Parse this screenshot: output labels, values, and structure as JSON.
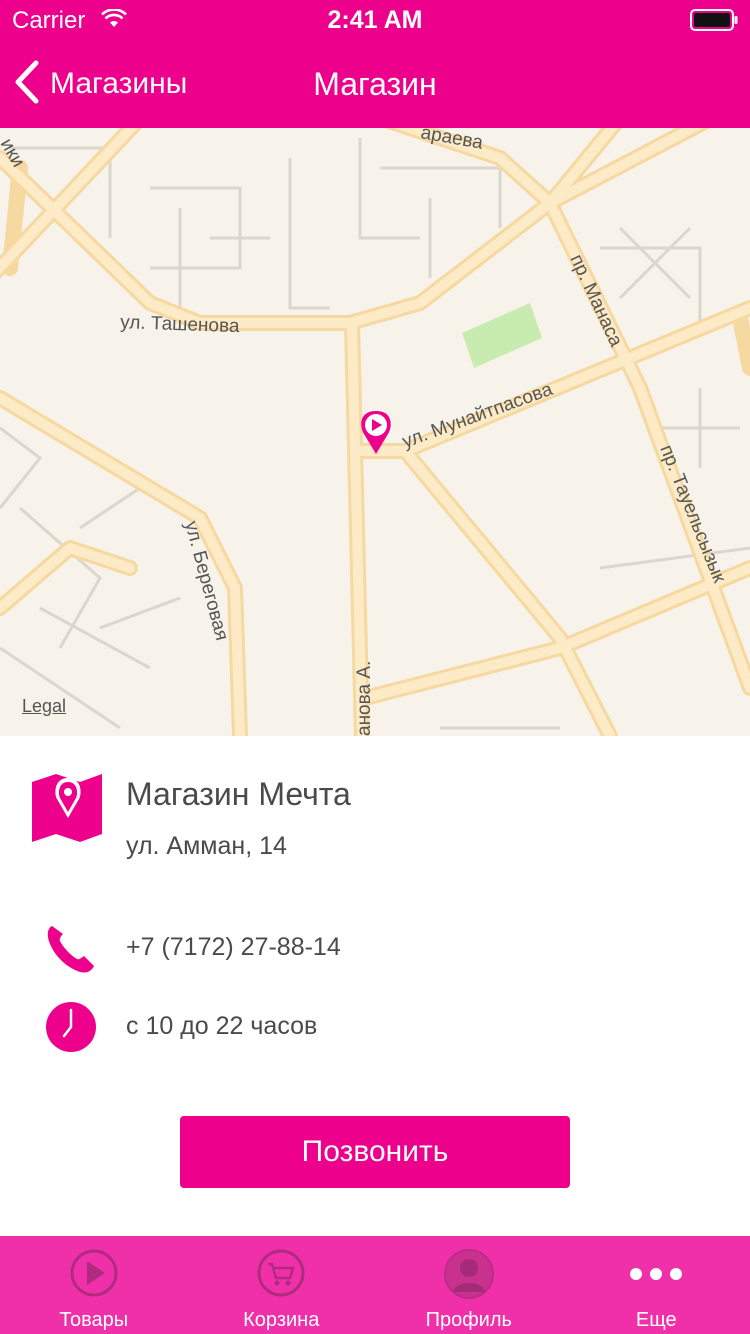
{
  "status_bar": {
    "carrier": "Carrier",
    "time": "2:41 AM"
  },
  "nav": {
    "back_label": "Магазины",
    "title": "Магазин"
  },
  "map": {
    "legal": "Legal",
    "streets": [
      "ул. Ташенова",
      "ул. Мунайтпасова",
      "пр. Манаса",
      "пр. Тауельсызык",
      "ул. Береговая",
      "анова А.",
      "араева",
      "ики"
    ]
  },
  "store": {
    "name": "Магазин Мечта",
    "address": "ул. Амман, 14",
    "phone": "+7 (7172) 27-88-14",
    "hours": "с 10 до 22 часов"
  },
  "call_button": "Позвонить",
  "tabs": [
    {
      "label": "Товары",
      "icon": "play-circle-icon"
    },
    {
      "label": "Корзина",
      "icon": "cart-icon"
    },
    {
      "label": "Профиль",
      "icon": "profile-icon"
    },
    {
      "label": "Еще",
      "icon": "more-dots-icon"
    }
  ],
  "colors": {
    "accent": "#ec008c",
    "tabbar": "#f030a8",
    "map_bg": "#f8f3ea",
    "road": "#fbdea3"
  }
}
